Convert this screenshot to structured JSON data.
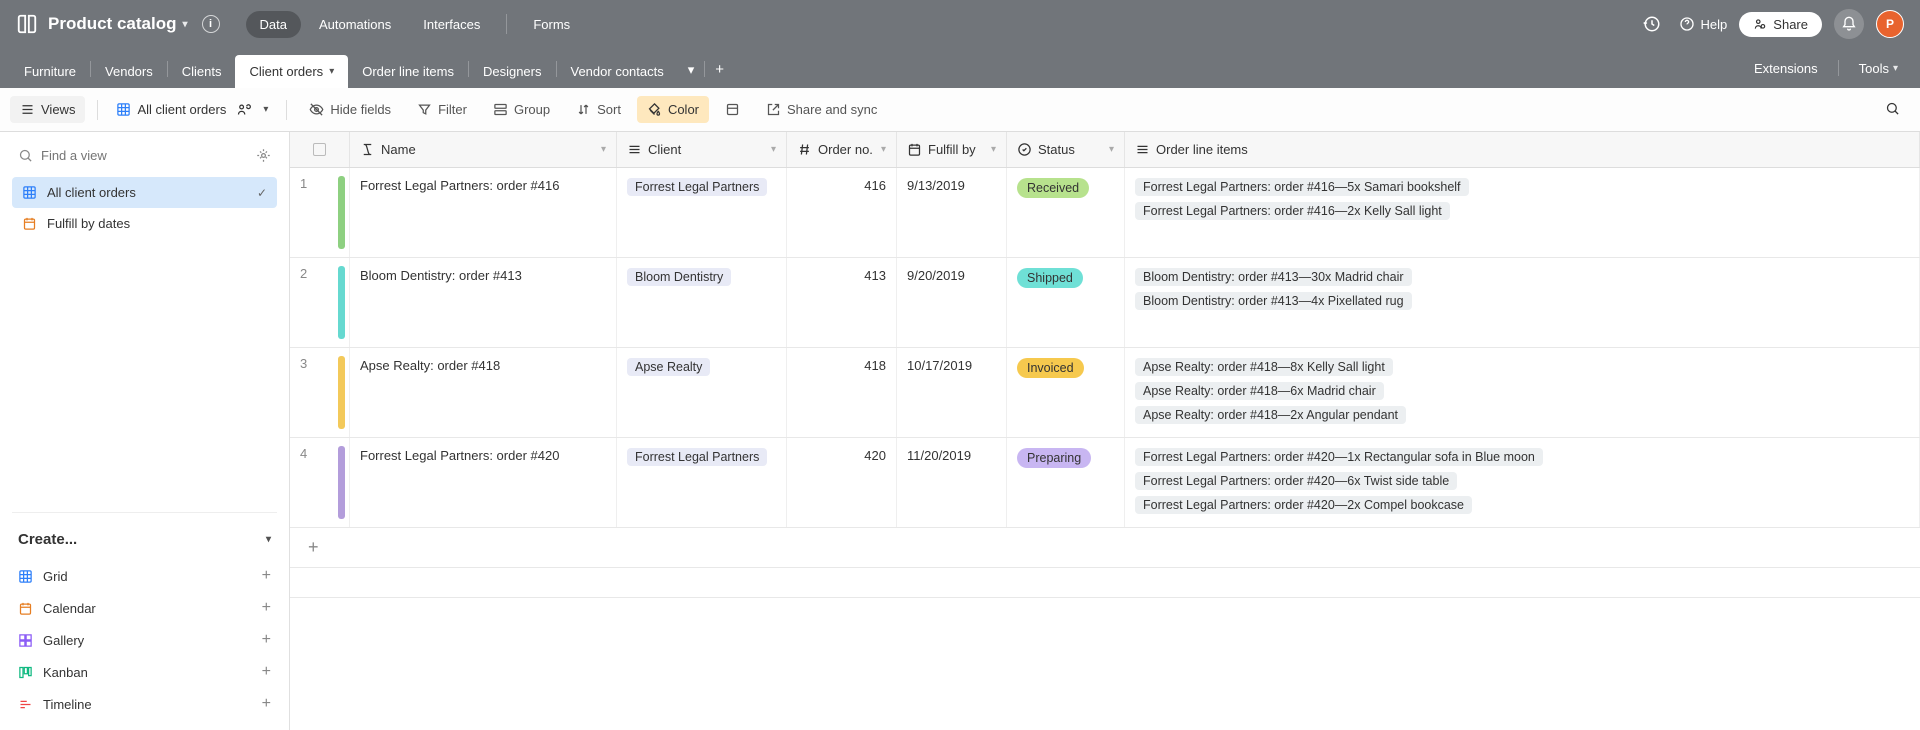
{
  "header": {
    "title": "Product catalog",
    "tabs": [
      "Data",
      "Automations",
      "Interfaces",
      "Forms"
    ],
    "activeTab": 0,
    "help": "Help",
    "share": "Share",
    "avatar": "P"
  },
  "tables": {
    "items": [
      "Furniture",
      "Vendors",
      "Clients",
      "Client orders",
      "Order line items",
      "Designers",
      "Vendor contacts"
    ],
    "activeIndex": 3,
    "extensions": "Extensions",
    "tools": "Tools"
  },
  "toolbar": {
    "views_label": "Views",
    "current_view": "All client orders",
    "hide_fields": "Hide fields",
    "filter": "Filter",
    "group": "Group",
    "sort": "Sort",
    "color": "Color",
    "share_sync": "Share and sync"
  },
  "sidebar": {
    "find_placeholder": "Find a view",
    "views": [
      {
        "label": "All client orders",
        "icon": "grid",
        "active": true
      },
      {
        "label": "Fulfill by dates",
        "icon": "calendar",
        "active": false
      }
    ],
    "create_label": "Create...",
    "create_items": [
      {
        "label": "Grid",
        "icon": "grid"
      },
      {
        "label": "Calendar",
        "icon": "calendar"
      },
      {
        "label": "Gallery",
        "icon": "gallery"
      },
      {
        "label": "Kanban",
        "icon": "kanban"
      },
      {
        "label": "Timeline",
        "icon": "timeline"
      }
    ]
  },
  "columns": {
    "name": "Name",
    "client": "Client",
    "order_no": "Order no.",
    "fulfill_by": "Fulfill by",
    "status": "Status",
    "order_line_items": "Order line items"
  },
  "status_colors": {
    "Received": "#b7e28d",
    "Shipped": "#6fe0d6",
    "Invoiced": "#f6c94e",
    "Preparing": "#c8b6f2"
  },
  "row_colors": [
    "#8ed081",
    "#66d9d0",
    "#f3c95a",
    "#b39ddb"
  ],
  "rows": [
    {
      "name": "Forrest Legal Partners: order #416",
      "client": "Forrest Legal Partners",
      "order_no": "416",
      "fulfill_by": "9/13/2019",
      "status": "Received",
      "items": [
        "Forrest Legal Partners: order #416—5x Samari bookshelf",
        "Forrest Legal Partners: order #416—2x Kelly Sall light"
      ]
    },
    {
      "name": "Bloom Dentistry: order #413",
      "client": "Bloom Dentistry",
      "order_no": "413",
      "fulfill_by": "9/20/2019",
      "status": "Shipped",
      "items": [
        "Bloom Dentistry: order #413—30x Madrid chair",
        "Bloom Dentistry: order #413—4x Pixellated rug"
      ]
    },
    {
      "name": "Apse Realty: order #418",
      "client": "Apse Realty",
      "order_no": "418",
      "fulfill_by": "10/17/2019",
      "status": "Invoiced",
      "items": [
        "Apse Realty: order #418—8x Kelly Sall light",
        "Apse Realty: order #418—6x Madrid chair",
        "Apse Realty: order #418—2x Angular pendant"
      ]
    },
    {
      "name": "Forrest Legal Partners: order #420",
      "client": "Forrest Legal Partners",
      "order_no": "420",
      "fulfill_by": "11/20/2019",
      "status": "Preparing",
      "items": [
        "Forrest Legal Partners: order #420—1x Rectangular sofa in Blue moon",
        "Forrest Legal Partners: order #420—6x Twist side table",
        "Forrest Legal Partners: order #420—2x Compel bookcase"
      ]
    }
  ]
}
